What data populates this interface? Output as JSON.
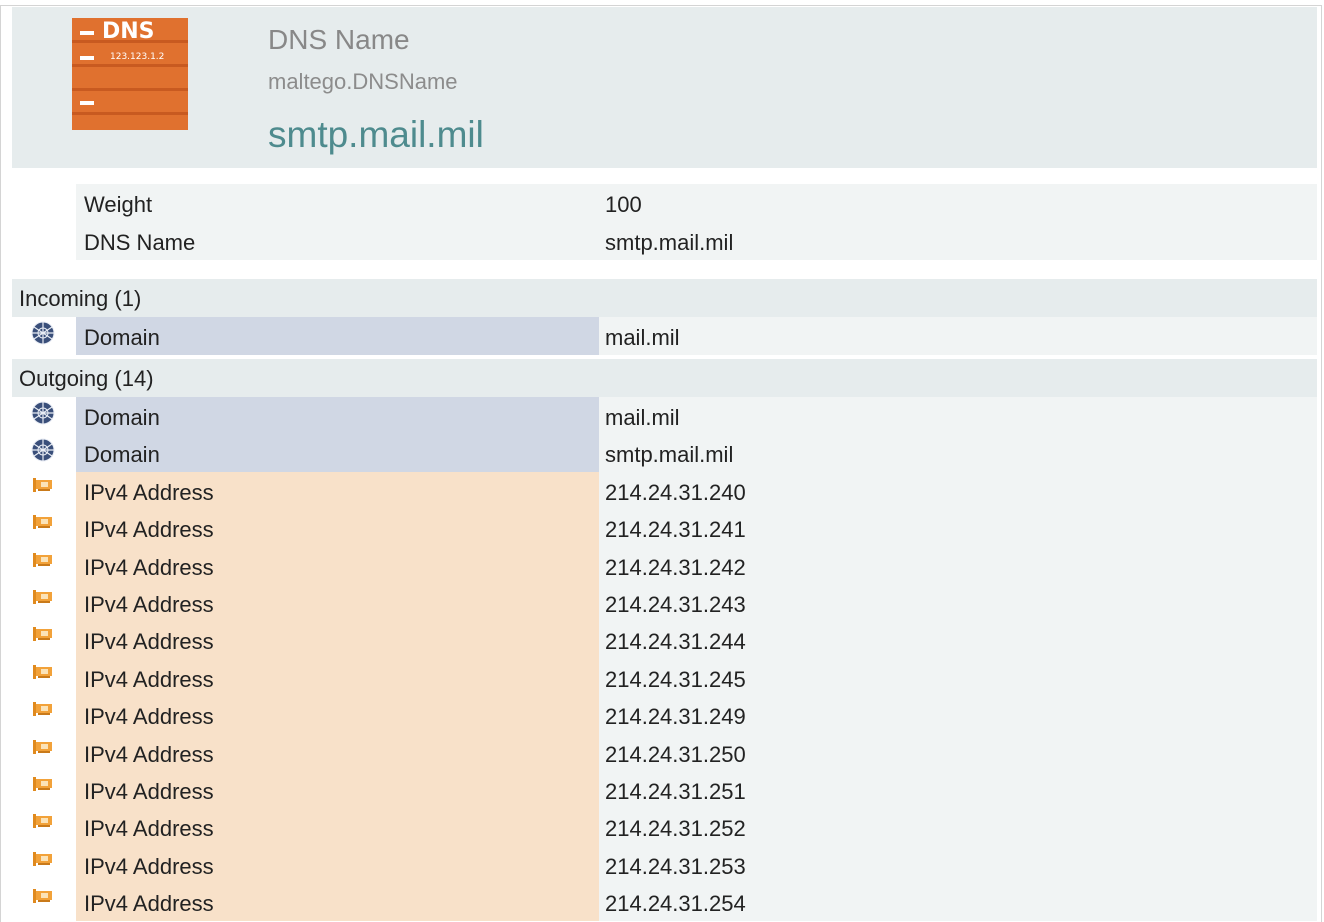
{
  "entity": {
    "type_name": "DNS Name",
    "type_id": "maltego.DNSName",
    "value": "smtp.mail.mil",
    "icon": "dns-name-icon",
    "icon_text": "DNS",
    "icon_ip": "123.123.1.2",
    "icon_color": "#e0712f"
  },
  "properties": [
    {
      "key": "Weight",
      "value": "100"
    },
    {
      "key": "DNS Name",
      "value": "smtp.mail.mil"
    }
  ],
  "incoming": {
    "title": "Incoming (1)",
    "items": [
      {
        "type": "Domain",
        "value": "mail.mil",
        "icon": "globe-icon"
      }
    ]
  },
  "outgoing": {
    "title": "Outgoing (14)",
    "items": [
      {
        "type": "Domain",
        "value": "mail.mil",
        "icon": "globe-icon"
      },
      {
        "type": "Domain",
        "value": "smtp.mail.mil",
        "icon": "globe-icon"
      },
      {
        "type": "IPv4 Address",
        "value": "214.24.31.240",
        "icon": "network-card-icon"
      },
      {
        "type": "IPv4 Address",
        "value": "214.24.31.241",
        "icon": "network-card-icon"
      },
      {
        "type": "IPv4 Address",
        "value": "214.24.31.242",
        "icon": "network-card-icon"
      },
      {
        "type": "IPv4 Address",
        "value": "214.24.31.243",
        "icon": "network-card-icon"
      },
      {
        "type": "IPv4 Address",
        "value": "214.24.31.244",
        "icon": "network-card-icon"
      },
      {
        "type": "IPv4 Address",
        "value": "214.24.31.245",
        "icon": "network-card-icon"
      },
      {
        "type": "IPv4 Address",
        "value": "214.24.31.249",
        "icon": "network-card-icon"
      },
      {
        "type": "IPv4 Address",
        "value": "214.24.31.250",
        "icon": "network-card-icon"
      },
      {
        "type": "IPv4 Address",
        "value": "214.24.31.251",
        "icon": "network-card-icon"
      },
      {
        "type": "IPv4 Address",
        "value": "214.24.31.252",
        "icon": "network-card-icon"
      },
      {
        "type": "IPv4 Address",
        "value": "214.24.31.253",
        "icon": "network-card-icon"
      },
      {
        "type": "IPv4 Address",
        "value": "214.24.31.254",
        "icon": "network-card-icon"
      }
    ]
  },
  "colors": {
    "header_bg": "#e6eced",
    "value_text": "#4e8b8e",
    "domain_cell": "#d0d7e4",
    "ipv4_cell": "#f8e1c9",
    "value_cell": "#f1f4f4"
  }
}
